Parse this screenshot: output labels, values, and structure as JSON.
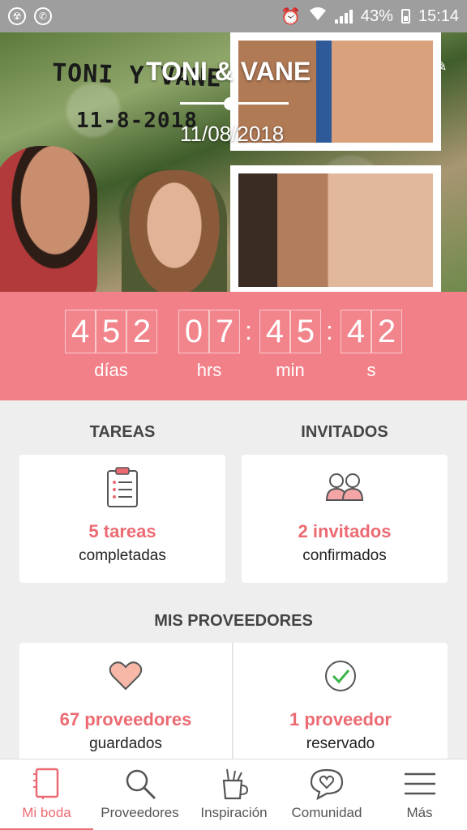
{
  "status_bar": {
    "battery": "43%",
    "time": "15:14"
  },
  "hero": {
    "handwritten_title": "TONI Y VANE",
    "handwritten_date": "11-8-2018",
    "couple_name": "TONI & VANE",
    "wedding_date": "11/08/2018"
  },
  "countdown": {
    "days": [
      "4",
      "5",
      "2"
    ],
    "hours": [
      "0",
      "7"
    ],
    "minutes": [
      "4",
      "5"
    ],
    "seconds": [
      "4",
      "2"
    ],
    "labels": {
      "days": "días",
      "hours": "hrs",
      "minutes": "min",
      "seconds": "s"
    }
  },
  "tasks": {
    "title": "TAREAS",
    "count": "5 tareas",
    "sub": "completadas"
  },
  "guests": {
    "title": "INVITADOS",
    "count": "2 invitados",
    "sub": "confirmados"
  },
  "vendors": {
    "title": "MIS PROVEEDORES",
    "saved": {
      "count": "67 proveedores",
      "sub": "guardados"
    },
    "booked": {
      "count": "1 proveedor",
      "sub": "reservado"
    }
  },
  "nav": {
    "items": [
      {
        "label": "Mi boda",
        "icon": "notebook-icon"
      },
      {
        "label": "Proveedores",
        "icon": "search-icon"
      },
      {
        "label": "Inspiración",
        "icon": "brush-cup-icon"
      },
      {
        "label": "Comunidad",
        "icon": "heart-chat-icon"
      },
      {
        "label": "Más",
        "icon": "menu-icon"
      }
    ]
  },
  "colors": {
    "accent": "#f28088",
    "accent_text": "#ec6a72",
    "status_bar": "#9e9e9e"
  }
}
